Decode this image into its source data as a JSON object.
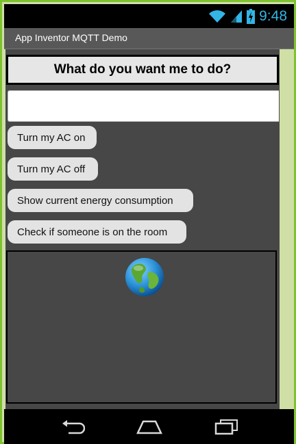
{
  "status_bar": {
    "time": "9:48",
    "icons": [
      "wifi-icon",
      "cell-signal-icon",
      "battery-charging-icon"
    ],
    "accent_color": "#33b5e5"
  },
  "action_bar": {
    "title": "App Inventor MQTT Demo"
  },
  "main": {
    "heading": "What do you want me to do?",
    "command_input": {
      "value": "",
      "placeholder": ""
    },
    "buttons": {
      "ac_on": "Turn my AC on",
      "ac_off": "Turn my AC off",
      "energy": "Show current energy consumption",
      "room": "Check if someone is on the room"
    },
    "image_icon": "globe-icon"
  },
  "nav_bar": {
    "icons": [
      "back-icon",
      "home-icon",
      "recents-icon"
    ]
  },
  "colors": {
    "frame": "#7ec230",
    "side_panel": "#cfdfa6",
    "content_bg": "#474747",
    "button_bg": "#e3e3e3"
  }
}
